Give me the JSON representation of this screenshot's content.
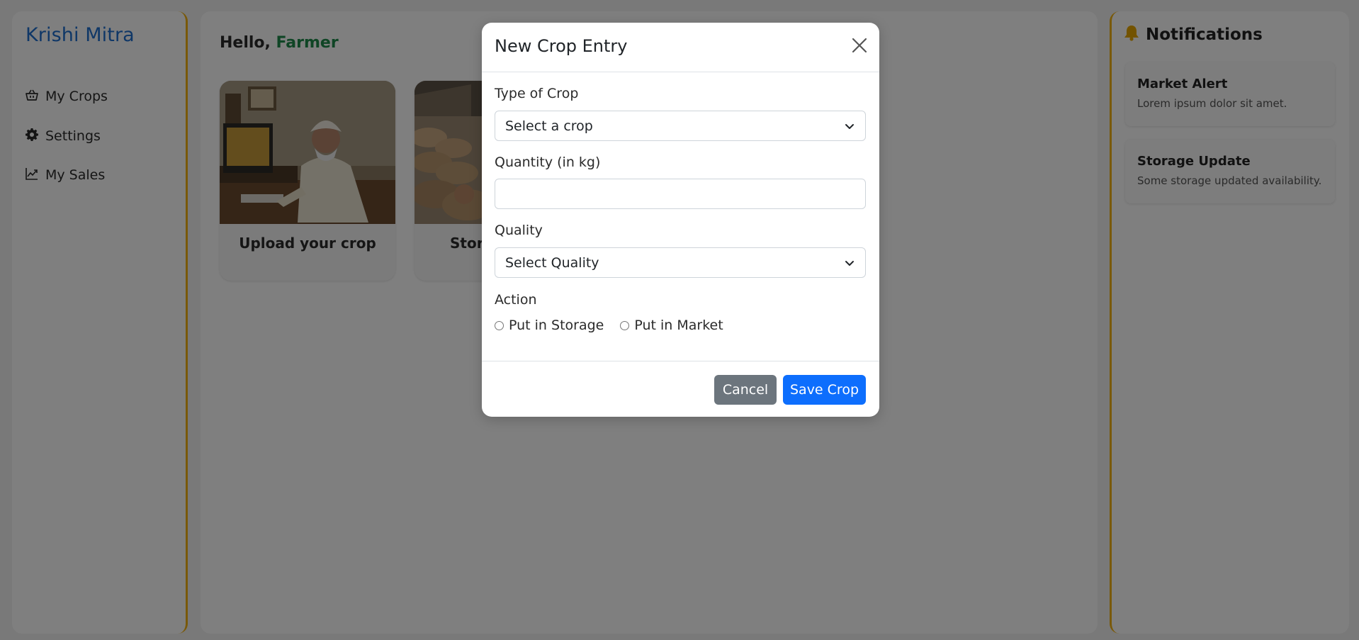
{
  "sidebar": {
    "brand": "Krishi Mitra",
    "items": [
      {
        "label": "My Crops",
        "icon": "basket-icon"
      },
      {
        "label": "Settings",
        "icon": "gear-icon"
      },
      {
        "label": "My Sales",
        "icon": "chart-line-icon"
      }
    ]
  },
  "main": {
    "greeting_prefix": "Hello, ",
    "greeting_name": "Farmer",
    "cards": [
      {
        "title": "Upload your crop"
      },
      {
        "title": "Store"
      }
    ]
  },
  "notifications": {
    "title": "Notifications",
    "items": [
      {
        "title": "Market Alert",
        "text": "Lorem ipsum dolor sit amet."
      },
      {
        "title": "Storage Update",
        "text": "Some storage updated availability."
      }
    ]
  },
  "modal": {
    "title": "New Crop Entry",
    "crop_type_label": "Type of Crop",
    "crop_type_value": "Select a crop",
    "quantity_label": "Quantity (in kg)",
    "quantity_value": "",
    "quality_label": "Quality",
    "quality_value": "Select Quality",
    "action_label": "Action",
    "action_options": [
      "Put in Storage",
      "Put in Market"
    ],
    "cancel_label": "Cancel",
    "save_label": "Save Crop"
  },
  "colors": {
    "brand": "#1f6fcf",
    "accent_border": "#f3b312",
    "greeting_name": "#1e8a4a",
    "primary_button": "#0d6efd",
    "secondary_button": "#6c757d",
    "bell": "#e6a700"
  }
}
